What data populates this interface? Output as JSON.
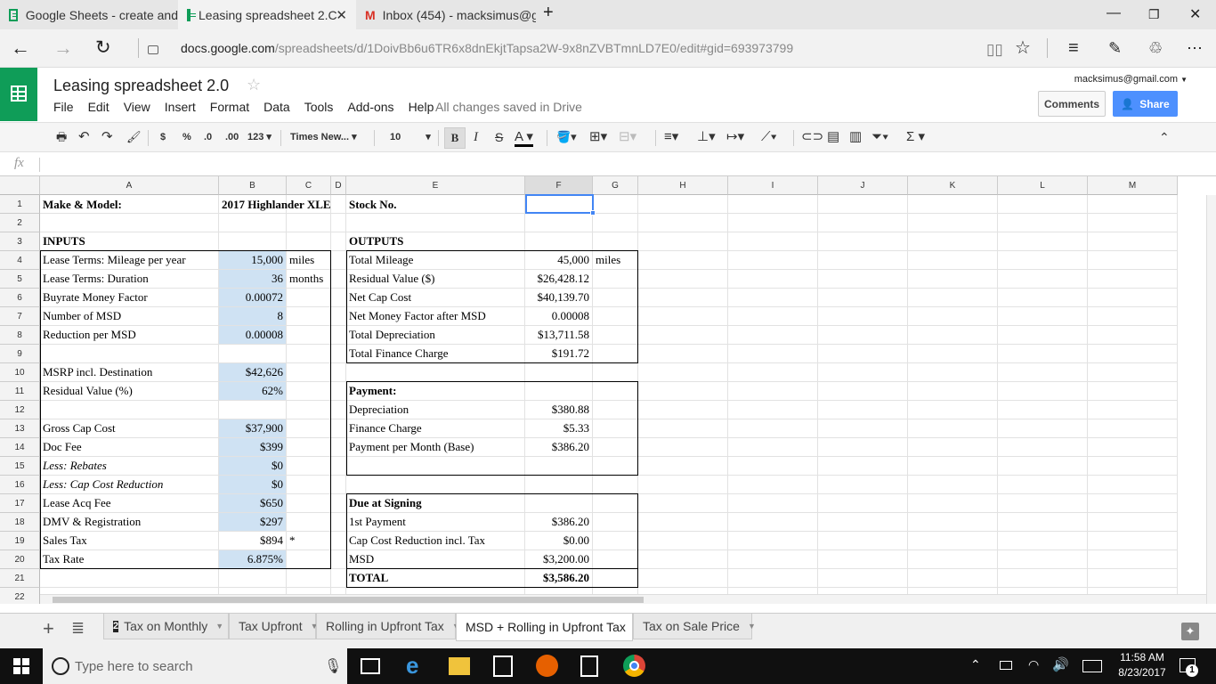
{
  "browser": {
    "tabs": [
      {
        "title": "Google Sheets - create and"
      },
      {
        "title": "Leasing spreadsheet 2.C"
      },
      {
        "title": "Inbox (454) - macksimus@g"
      }
    ],
    "url_host": "docs.google.com",
    "url_path": "/spreadsheets/d/1DoivBb6u6TR6x8dnEkjtTapsa2W-9x8nZVBTmnLD7E0/edit#gid=693973799"
  },
  "doc": {
    "title": "Leasing spreadsheet 2.0",
    "menus": [
      "File",
      "Edit",
      "View",
      "Insert",
      "Format",
      "Data",
      "Tools",
      "Add-ons",
      "Help"
    ],
    "saved_status": "All changes saved in Drive",
    "account": "macksimus@gmail.com",
    "comments_label": "Comments",
    "share_label": "Share"
  },
  "toolbar": {
    "currency": "$",
    "percent": "%",
    "dec_less": ".0",
    "dec_more": ".00",
    "format_more": "123",
    "font": "Times New...",
    "font_size": "10",
    "bold": "B",
    "italic": "I",
    "strike": "S",
    "text_color": "A",
    "sum": "Σ"
  },
  "fx_label": "fx",
  "columns": [
    "A",
    "B",
    "C",
    "D",
    "E",
    "F",
    "G",
    "H",
    "I",
    "J",
    "K",
    "L",
    "M"
  ],
  "rows": [
    "1",
    "2",
    "3",
    "4",
    "5",
    "6",
    "7",
    "8",
    "9",
    "10",
    "11",
    "12",
    "13",
    "14",
    "15",
    "16",
    "17",
    "18",
    "19",
    "20",
    "21",
    "22"
  ],
  "cells": {
    "A1": "Make & Model:",
    "B1": "2017 Highlander  XLE",
    "E1": "Stock No.",
    "A3": "INPUTS",
    "E3": "OUTPUTS",
    "A4": "Lease Terms: Mileage per year",
    "B4": "15,000",
    "C4": "miles",
    "E4": "Total Mileage",
    "F4": "45,000",
    "G4": "miles",
    "A5": "Lease Terms: Duration",
    "B5": "36",
    "C5": "months",
    "E5": "Residual Value ($)",
    "F5": "$26,428.12",
    "A6": "Buyrate Money Factor",
    "B6": "0.00072",
    "E6": "Net Cap Cost",
    "F6": "$40,139.70",
    "A7": "Number of MSD",
    "B7": "8",
    "E7": "Net Money Factor after MSD",
    "F7": "0.00008",
    "A8": "Reduction per MSD",
    "B8": "0.00008",
    "E8": "Total Depreciation",
    "F8": "$13,711.58",
    "E9": "Total Finance Charge",
    "F9": "$191.72",
    "A10": "MSRP incl. Destination",
    "B10": "$42,626",
    "A11": "Residual Value (%)",
    "B11": "62%",
    "E11": "Payment:",
    "E12": "Depreciation",
    "F12": "$380.88",
    "A13": "Gross Cap Cost",
    "B13": "$37,900",
    "E13": "Finance Charge",
    "F13": "$5.33",
    "A14": "Doc Fee",
    "B14": "$399",
    "E14": "Payment per Month (Base)",
    "F14": "$386.20",
    "A15": "Less: Rebates",
    "B15": "$0",
    "A16": "Less: Cap Cost Reduction",
    "B16": "$0",
    "A17": "Lease Acq Fee",
    "B17": "$650",
    "E17": "Due at Signing",
    "A18": "DMV & Registration",
    "B18": "$297",
    "E18": "1st Payment",
    "F18": "$386.20",
    "A19": "Sales Tax",
    "B19": "$894",
    "C19": "*",
    "E19": "Cap Cost Reduction incl. Tax",
    "F19": "$0.00",
    "A20": "Tax Rate",
    "B20": "6.875%",
    "E20": "MSD",
    "F20": "$3,200.00",
    "E21": "TOTAL",
    "F21": "$3,586.20"
  },
  "sheet_tabs": [
    {
      "badge": "2",
      "label": "Tax on Monthly"
    },
    {
      "label": "Tax Upfront"
    },
    {
      "label": "Rolling in Upfront Tax"
    },
    {
      "label": "MSD + Rolling in Upfront Tax"
    },
    {
      "label": "Tax on Sale Price"
    }
  ],
  "taskbar": {
    "search_placeholder": "Type here to search",
    "time": "11:58 AM",
    "date": "8/23/2017",
    "notifications": "1"
  },
  "colors": {
    "sheets_green": "#0f9d58",
    "share_blue": "#4d90fe",
    "input_cell_blue": "#cfe2f3",
    "selection_blue": "#4285f4"
  }
}
